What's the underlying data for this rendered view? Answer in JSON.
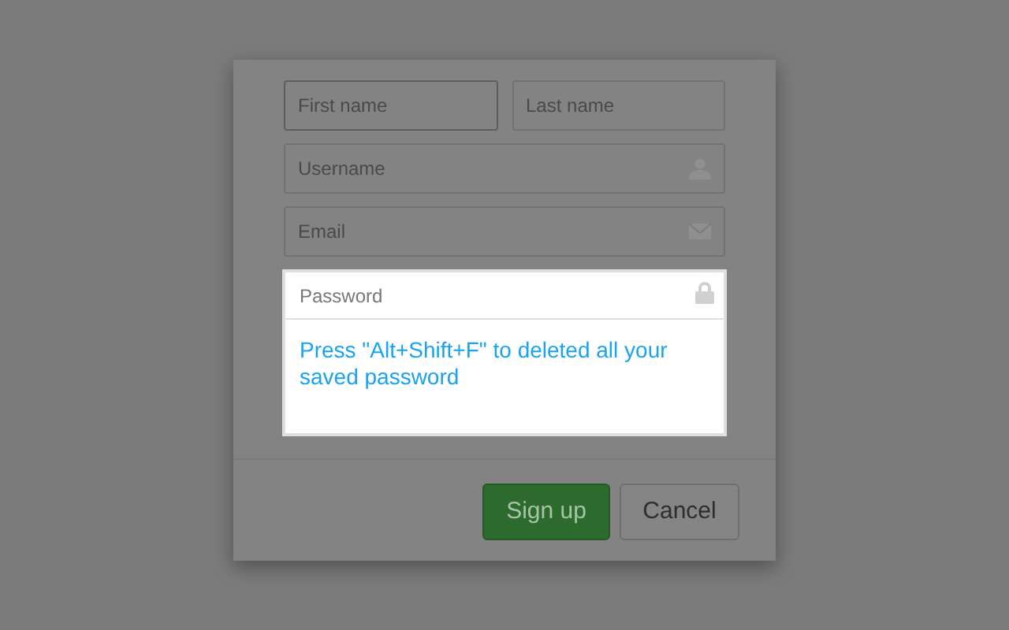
{
  "name_fields": [
    {
      "placeholder": "First name",
      "focused": true
    },
    {
      "placeholder": "Last name",
      "focused": false
    }
  ],
  "fields": [
    {
      "placeholder": "Username",
      "kind": "user",
      "highlighted": false
    },
    {
      "placeholder": "Email",
      "kind": "mail",
      "highlighted": false
    },
    {
      "placeholder": "Password",
      "kind": "lock",
      "highlighted": true,
      "tip": "Press \"Alt+Shift+F\" to deleted all your saved password"
    }
  ],
  "buttons": [
    {
      "label": "Sign up",
      "kind": "primary"
    },
    {
      "label": "Cancel",
      "kind": "secondary"
    }
  ]
}
